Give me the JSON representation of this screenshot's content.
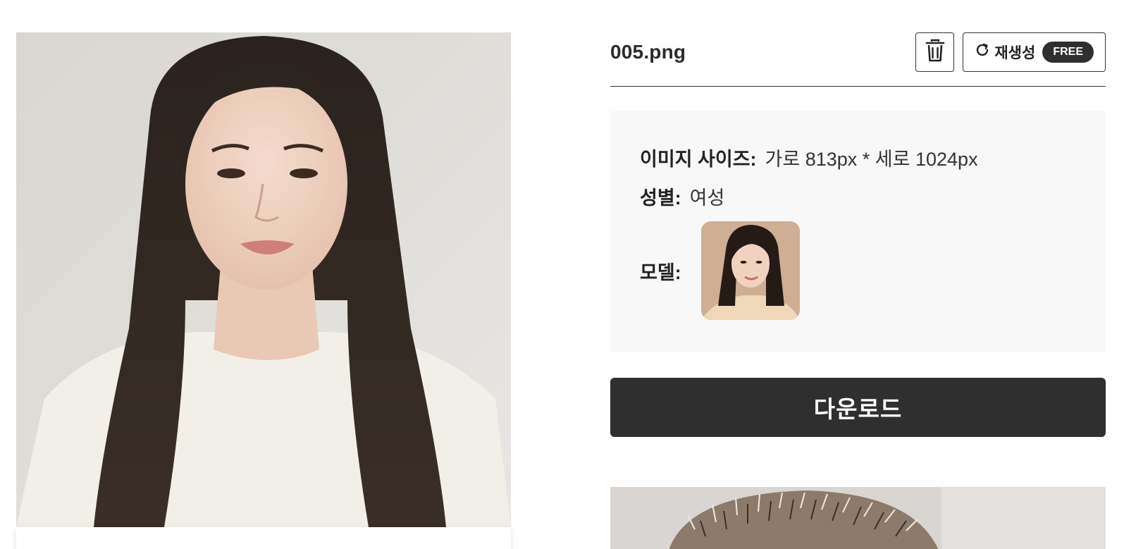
{
  "result": {
    "file_name": "005.png",
    "delete_icon": "trash-icon",
    "regenerate": {
      "icon": "refresh-icon",
      "label": "재생성",
      "badge": "FREE"
    }
  },
  "info": {
    "size_label": "이미지 사이즈:",
    "size_value": "가로 813px * 세로 1024px",
    "gender_label": "성별:",
    "gender_value": "여성",
    "model_label": "모델:"
  },
  "download_label": "다운로드",
  "colors": {
    "button_dark": "#2f2f2f",
    "card_bg": "#f8f8f8"
  }
}
